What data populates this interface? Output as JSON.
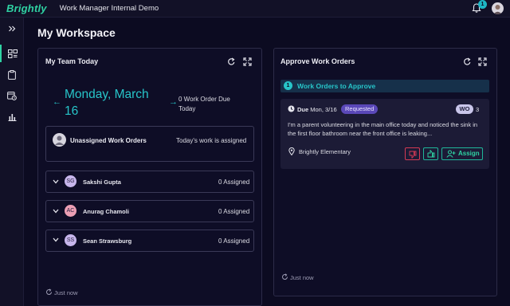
{
  "app": {
    "logo": "Brightly",
    "title": "Work Manager Internal Demo",
    "notification_count": "1"
  },
  "page": {
    "title": "My Workspace"
  },
  "team_card": {
    "title": "My Team Today",
    "date": "Monday, March 16",
    "due_text": "0 Work Order Due Today",
    "unassigned_label": "Unassigned Work Orders",
    "unassigned_status": "Today's work is assigned",
    "members": [
      {
        "initials": "SG",
        "name": "Sakshi Gupta",
        "assigned": "0 Assigned",
        "color": "#c7b6ec"
      },
      {
        "initials": "AC",
        "name": "Anurag Chamoli",
        "assigned": "0 Assigned",
        "color": "#ec9fb5"
      },
      {
        "initials": "SS",
        "name": "Sean Strawsburg",
        "assigned": "0 Assigned",
        "color": "#c7b6ec"
      }
    ],
    "footer": "Just now"
  },
  "approve_card": {
    "title": "Approve Work Orders",
    "section_count": "1",
    "section_label": "Work Orders to Approve",
    "work_order": {
      "due_prefix": "Due",
      "due_date": "Mon, 3/16",
      "status": "Requested",
      "type_badge": "WO",
      "type_count": "3",
      "description": "I'm a parent volunteering in the main office today and noticed the sink in the first floor bathroom near the front office is leaking...",
      "location": "Brightly Elementary",
      "assign_label": "Assign"
    },
    "footer": "Just now"
  },
  "colors": {
    "accent": "#2fd2a3",
    "teal": "#27c5c9",
    "requested": "#5a48b8",
    "reject": "#d63a55"
  }
}
